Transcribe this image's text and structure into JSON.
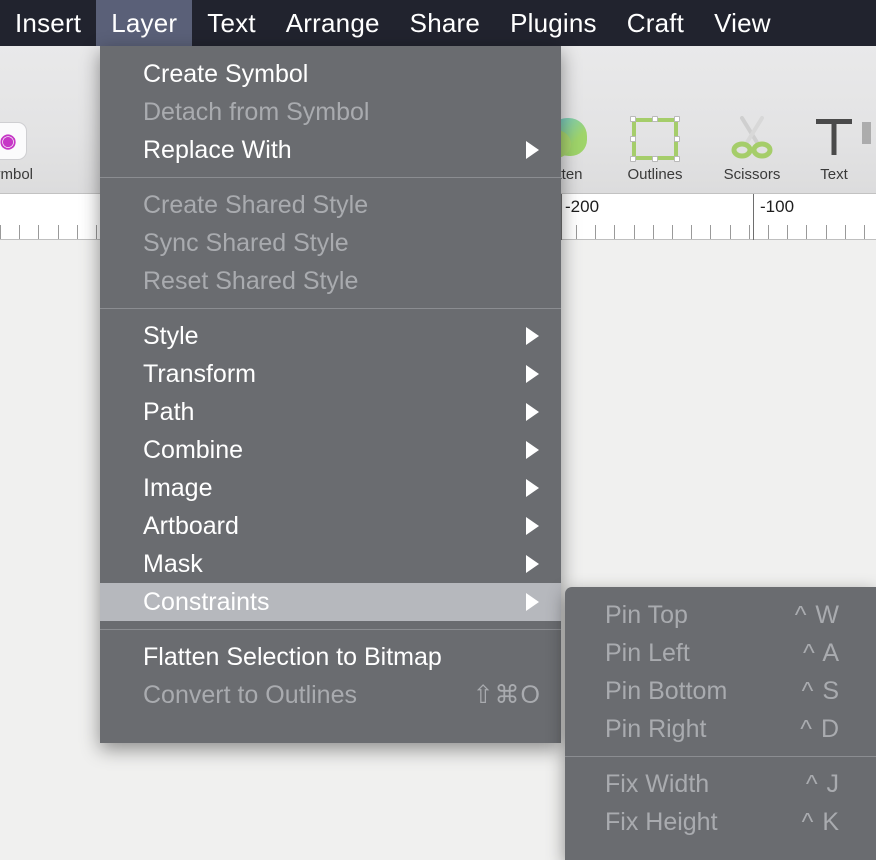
{
  "app": {
    "menubar": {
      "items": [
        {
          "label": "Insert",
          "active": false
        },
        {
          "label": "Layer",
          "active": true
        },
        {
          "label": "Text",
          "active": false
        },
        {
          "label": "Arrange",
          "active": false
        },
        {
          "label": "Share",
          "active": false
        },
        {
          "label": "Plugins",
          "active": false
        },
        {
          "label": "Craft",
          "active": false
        },
        {
          "label": "View",
          "active": false
        }
      ]
    },
    "toolbar": {
      "items": [
        {
          "label": "Symbol",
          "icon": "symbol-badge-icon"
        },
        {
          "label": "tten",
          "icon": "flatten-icon"
        },
        {
          "label": "Outlines",
          "icon": "outlines-square-icon"
        },
        {
          "label": "Scissors",
          "icon": "scissors-icon"
        },
        {
          "label": "Text",
          "icon": "text-t-icon"
        }
      ]
    },
    "ruler": {
      "labels": [
        "-200",
        "-100"
      ]
    }
  },
  "layer_menu": {
    "title": "Layer",
    "groups": [
      {
        "items": [
          {
            "label": "Create Symbol",
            "disabled": false,
            "submenu": false,
            "shortcut": "",
            "selected": false
          },
          {
            "label": "Detach from Symbol",
            "disabled": true,
            "submenu": false,
            "shortcut": "",
            "selected": false
          },
          {
            "label": "Replace With",
            "disabled": false,
            "submenu": true,
            "shortcut": "",
            "selected": false
          }
        ]
      },
      {
        "items": [
          {
            "label": "Create Shared Style",
            "disabled": true,
            "submenu": false,
            "shortcut": "",
            "selected": false
          },
          {
            "label": "Sync Shared Style",
            "disabled": true,
            "submenu": false,
            "shortcut": "",
            "selected": false
          },
          {
            "label": "Reset Shared Style",
            "disabled": true,
            "submenu": false,
            "shortcut": "",
            "selected": false
          }
        ]
      },
      {
        "items": [
          {
            "label": "Style",
            "disabled": false,
            "submenu": true,
            "shortcut": "",
            "selected": false
          },
          {
            "label": "Transform",
            "disabled": false,
            "submenu": true,
            "shortcut": "",
            "selected": false
          },
          {
            "label": "Path",
            "disabled": false,
            "submenu": true,
            "shortcut": "",
            "selected": false
          },
          {
            "label": "Combine",
            "disabled": false,
            "submenu": true,
            "shortcut": "",
            "selected": false
          },
          {
            "label": "Image",
            "disabled": false,
            "submenu": true,
            "shortcut": "",
            "selected": false
          },
          {
            "label": "Artboard",
            "disabled": false,
            "submenu": true,
            "shortcut": "",
            "selected": false
          },
          {
            "label": "Mask",
            "disabled": false,
            "submenu": true,
            "shortcut": "",
            "selected": false
          },
          {
            "label": "Constraints",
            "disabled": false,
            "submenu": true,
            "shortcut": "",
            "selected": true
          }
        ]
      },
      {
        "items": [
          {
            "label": "Flatten Selection to Bitmap",
            "disabled": false,
            "submenu": false,
            "shortcut": "",
            "selected": false
          },
          {
            "label": "Convert to Outlines",
            "disabled": true,
            "submenu": false,
            "shortcut": "⇧⌘O",
            "selected": false
          }
        ]
      }
    ]
  },
  "constraints_submenu": {
    "title": "Constraints",
    "groups": [
      {
        "items": [
          {
            "label": "Pin Top",
            "shortcut": "^ W",
            "disabled": true
          },
          {
            "label": "Pin Left",
            "shortcut": "^ A",
            "disabled": true
          },
          {
            "label": "Pin Bottom",
            "shortcut": "^ S",
            "disabled": true
          },
          {
            "label": "Pin Right",
            "shortcut": "^ D",
            "disabled": true
          }
        ]
      },
      {
        "items": [
          {
            "label": "Fix Width",
            "shortcut": "^ J",
            "disabled": true
          },
          {
            "label": "Fix Height",
            "shortcut": "^ K",
            "disabled": true
          }
        ]
      }
    ]
  },
  "colors": {
    "menubar_bg": "#21232e",
    "menubar_active": "#5a6078",
    "menu_bg": "#6a6c70",
    "menu_selected": "#b6b8bd",
    "menu_disabled_text": "#a9abaf",
    "accent_green": "#a5cd6a"
  }
}
